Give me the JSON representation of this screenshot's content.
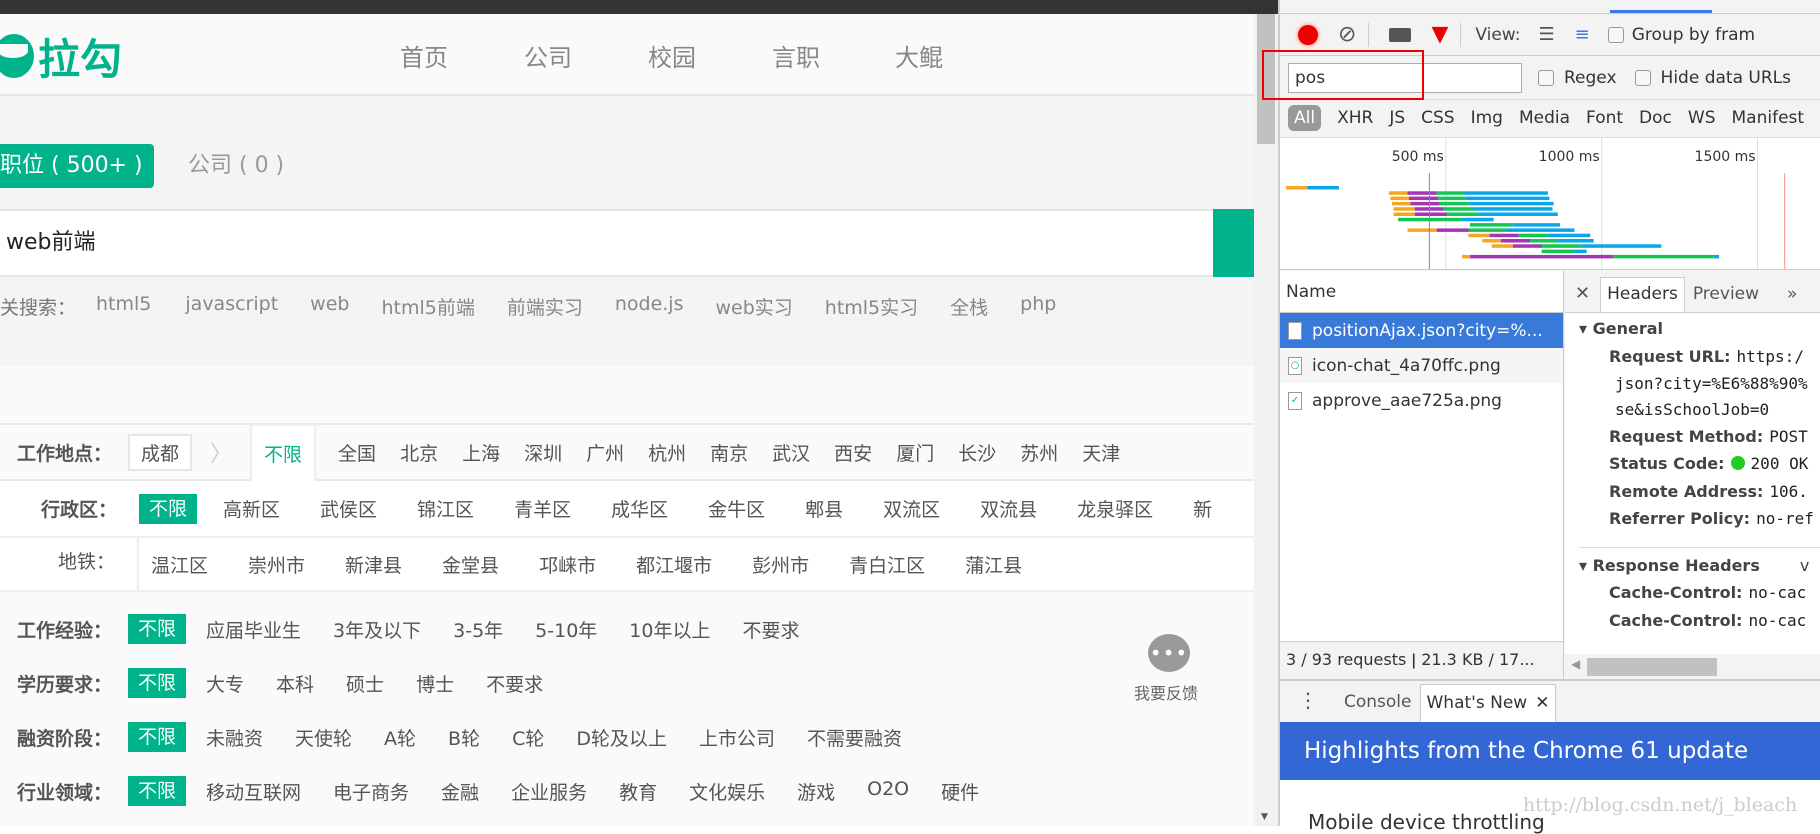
{
  "site": {
    "logo": "拉勾",
    "nav": [
      "首页",
      "公司",
      "校园",
      "言职",
      "大鲲"
    ],
    "tabs": [
      {
        "label": "职位 ( 500+ )",
        "active": true
      },
      {
        "label": "公司 ( 0 )",
        "active": false
      }
    ],
    "search_value": "web前端",
    "related_label": "关搜索：",
    "related": [
      "html5",
      "javascript",
      "web",
      "html5前端",
      "前端实习",
      "node.js",
      "web实习",
      "html5实习",
      "全栈",
      "php"
    ],
    "accent": "#00b38a",
    "location": {
      "label": "工作地点：",
      "city": "成都",
      "selected": "不限",
      "cities": [
        "全国",
        "北京",
        "上海",
        "深圳",
        "广州",
        "杭州",
        "南京",
        "武汉",
        "西安",
        "厦门",
        "长沙",
        "苏州",
        "天津"
      ]
    },
    "district": {
      "label": "行政区：",
      "selected": "不限",
      "items": [
        "高新区",
        "武侯区",
        "锦江区",
        "青羊区",
        "成华区",
        "金牛区",
        "郫县",
        "双流区",
        "双流县",
        "龙泉驿区",
        "新"
      ]
    },
    "subway": {
      "label": "地铁：",
      "items": [
        "温江区",
        "崇州市",
        "新津县",
        "金堂县",
        "邛崃市",
        "都江堰市",
        "彭州市",
        "青白江区",
        "蒲江县"
      ]
    },
    "filters": [
      {
        "label": "工作经验：",
        "selected": "不限",
        "items": [
          "应届毕业生",
          "3年及以下",
          "3-5年",
          "5-10年",
          "10年以上",
          "不要求"
        ]
      },
      {
        "label": "学历要求：",
        "selected": "不限",
        "items": [
          "大专",
          "本科",
          "硕士",
          "博士",
          "不要求"
        ]
      },
      {
        "label": "融资阶段：",
        "selected": "不限",
        "items": [
          "未融资",
          "天使轮",
          "A轮",
          "B轮",
          "C轮",
          "D轮及以上",
          "上市公司",
          "不需要融资"
        ]
      },
      {
        "label": "行业领域：",
        "selected": "不限",
        "items": [
          "移动互联网",
          "电子商务",
          "金融",
          "企业服务",
          "教育",
          "文化娱乐",
          "游戏",
          "O2O",
          "硬件"
        ]
      }
    ],
    "feedback": "我要反馈"
  },
  "devtools": {
    "toolbar": {
      "view_label": "View:",
      "group_by": "Group by fram"
    },
    "filter": {
      "value": "pos",
      "regex": "Regex",
      "hide_data": "Hide data URLs"
    },
    "types": [
      "All",
      "XHR",
      "JS",
      "CSS",
      "Img",
      "Media",
      "Font",
      "Doc",
      "WS",
      "Manifest"
    ],
    "timeline_ticks": [
      "500 ms",
      "1000 ms",
      "1500 ms"
    ],
    "name_header": "Name",
    "requests": [
      {
        "name": "positionAjax.json?city=%...",
        "icon": "document-icon",
        "selected": true
      },
      {
        "name": "icon-chat_4a70ffc.png",
        "icon": "image-icon"
      },
      {
        "name": "approve_aae725a.png",
        "icon": "image-icon"
      }
    ],
    "summary": "3 / 93 requests  ǀ  21.3 KB / 17...",
    "detail_tabs": [
      "Headers",
      "Preview"
    ],
    "general": {
      "title": "General",
      "rows": [
        {
          "k": "Request URL:",
          "v": "https:/"
        },
        {
          "k": "",
          "v": "json?city=%E6%88%90%"
        },
        {
          "k": "",
          "v": "se&isSchoolJob=0"
        },
        {
          "k": "Request Method:",
          "v": "POST"
        },
        {
          "k": "Status Code:",
          "v": "200 OK"
        },
        {
          "k": "Remote Address:",
          "v": "106."
        },
        {
          "k": "Referrer Policy:",
          "v": "no-ref"
        }
      ]
    },
    "response_headers": {
      "title": "Response Headers",
      "view": "v",
      "rows": [
        {
          "k": "Cache-Control:",
          "v": "no-cac"
        },
        {
          "k": "Cache-Control:",
          "v": "no-cac"
        }
      ]
    },
    "drawer_tabs": [
      "Console",
      "What's New"
    ],
    "banner": "Highlights from the Chrome 61 update",
    "banner_color": "#3367d6",
    "whatsnew_item": "Mobile device throttling",
    "watermark": "http://blog.csdn.net/j_bleach"
  }
}
